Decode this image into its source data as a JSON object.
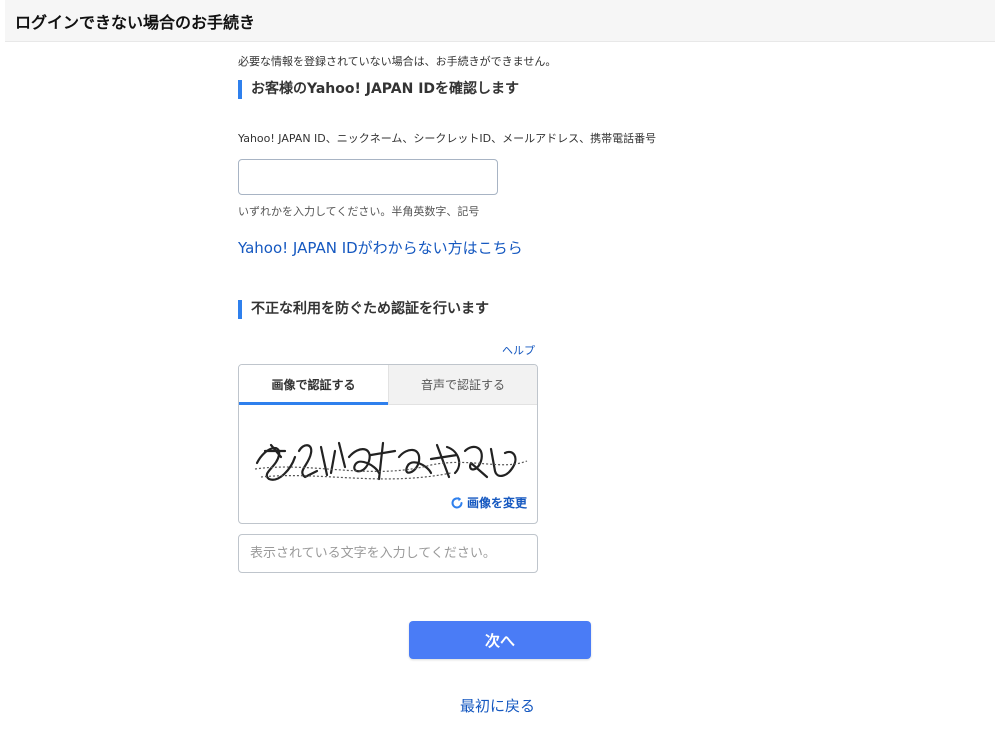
{
  "header": {
    "title": "ログインできない場合のお手続き"
  },
  "notice": "必要な情報を登録されていない場合は、お手続きができません。",
  "id_section": {
    "title": "お客様のYahoo! JAPAN IDを確認します",
    "field_label": "Yahoo! JAPAN ID、ニックネーム、シークレットID、メールアドレス、携帯電話番号",
    "input_value": "",
    "hint": "いずれかを入力してください。半角英数字、記号",
    "forgot_link": "Yahoo! JAPAN IDがわからない方はこちら"
  },
  "captcha_section": {
    "title": "不正な利用を防ぐため認証を行います",
    "help_link": "ヘルプ",
    "tabs": [
      {
        "label": "画像で認証する",
        "active": true
      },
      {
        "label": "音声で認証する",
        "active": false
      }
    ],
    "change_image": "画像を変更",
    "input_placeholder": "表示されている文字を入力してください。",
    "refresh_icon": "refresh-icon"
  },
  "actions": {
    "next_label": "次へ",
    "back_label": "最初に戻る"
  },
  "colors": {
    "accent": "#2f80ed",
    "button": "#4a7cf6",
    "link": "#1558c0"
  }
}
